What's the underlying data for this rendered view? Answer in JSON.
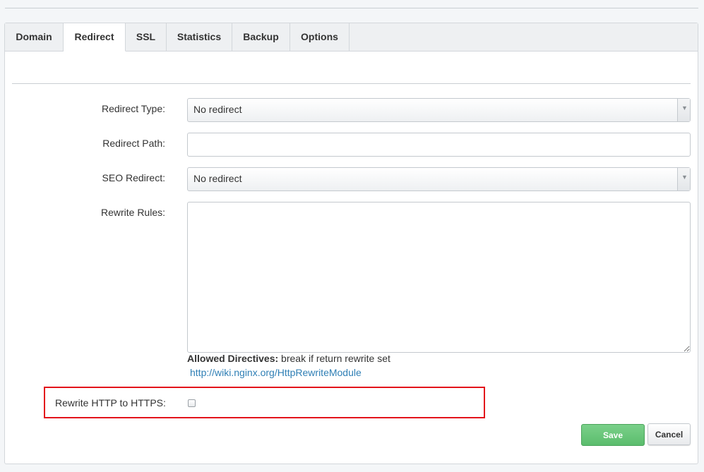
{
  "tabs": [
    {
      "label": "Domain"
    },
    {
      "label": "Redirect"
    },
    {
      "label": "SSL"
    },
    {
      "label": "Statistics"
    },
    {
      "label": "Backup"
    },
    {
      "label": "Options"
    }
  ],
  "active_tab": "Redirect",
  "form": {
    "redirect_type": {
      "label": "Redirect Type:",
      "value": "No redirect"
    },
    "redirect_path": {
      "label": "Redirect Path:",
      "value": ""
    },
    "seo_redirect": {
      "label": "SEO Redirect:",
      "value": "No redirect"
    },
    "rewrite_rules": {
      "label": "Rewrite Rules:",
      "value": ""
    },
    "allowed_directives": {
      "label": "Allowed Directives:",
      "value": "break if return rewrite set"
    },
    "help_link": "http://wiki.nginx.org/HttpRewriteModule",
    "rewrite_https": {
      "label": "Rewrite HTTP to HTTPS:",
      "checked": false
    }
  },
  "buttons": {
    "save": "Save",
    "cancel": "Cancel"
  },
  "colors": {
    "accent_green": "#5bbd6d",
    "link": "#2f7fb5",
    "highlight": "#e3141b"
  },
  "icons": {
    "select_arrow": "chevron-down-icon"
  }
}
